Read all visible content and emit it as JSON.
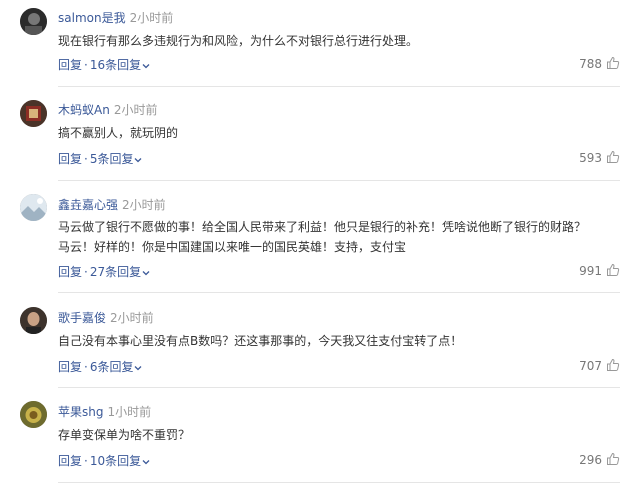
{
  "comments": [
    {
      "user": "salmon是我",
      "time": "2小时前",
      "text": [
        "现在银行有那么多违规行为和风险，为什么不对银行总行进行处理。"
      ],
      "reply_label": "回复",
      "dot": "·",
      "replies": "16条回复",
      "likes": "788",
      "avatar_color": "#3a3a3a"
    },
    {
      "user": "木蚂蚁An",
      "time": "2小时前",
      "text": [
        "搞不赢别人，就玩阴的"
      ],
      "reply_label": "回复",
      "dot": "·",
      "replies": "5条回复",
      "likes": "593",
      "avatar_color": "#6b4a3a"
    },
    {
      "user": "鑫垚嘉心强",
      "time": "2小时前",
      "text": [
        "马云做了银行不愿做的事！给全国人民带来了利益！他只是银行的补充！凭啥说他断了银行的财路？",
        "马云！好样的！你是中国建国以来唯一的国民英雄！支持，支付宝"
      ],
      "reply_label": "回复",
      "dot": "·",
      "replies": "27条回复",
      "likes": "991",
      "avatar_color": "#c9d6e0"
    },
    {
      "user": "歌手嘉俊",
      "time": "2小时前",
      "text": [
        "自己没有本事心里没有点B数吗？还这事那事的，今天我又往支付宝转了点！"
      ],
      "reply_label": "回复",
      "dot": "·",
      "replies": "6条回复",
      "likes": "707",
      "avatar_color": "#5a4a40"
    },
    {
      "user": "苹果shg",
      "time": "1小时前",
      "text": [
        "存单变保单为啥不重罚？"
      ],
      "reply_label": "回复",
      "dot": "·",
      "replies": "10条回复",
      "likes": "296",
      "avatar_color": "#8a8a3a"
    }
  ]
}
